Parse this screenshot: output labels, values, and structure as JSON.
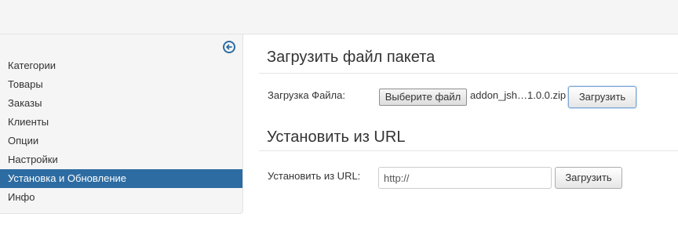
{
  "sidebar": {
    "collapse_icon": "arrow-left-circle-icon",
    "items": [
      {
        "label": "Категории",
        "active": false
      },
      {
        "label": "Товары",
        "active": false
      },
      {
        "label": "Заказы",
        "active": false
      },
      {
        "label": "Клиенты",
        "active": false
      },
      {
        "label": "Опции",
        "active": false
      },
      {
        "label": "Настройки",
        "active": false
      },
      {
        "label": "Установка и Обновление",
        "active": true
      },
      {
        "label": "Инфо",
        "active": false
      }
    ]
  },
  "upload_section": {
    "title": "Загрузить файл пакета",
    "field_label": "Загрузка Файла:",
    "choose_file_label": "Выберите файл",
    "selected_file": "addon_jsh…1.0.0.zip",
    "submit_label": "Загрузить"
  },
  "url_section": {
    "title": "Установить из URL",
    "field_label": "Установить из URL:",
    "url_value": "http://",
    "submit_label": "Загрузить"
  },
  "colors": {
    "accent": "#2d6ca2",
    "sidebar_bg": "#f5f5f5"
  }
}
